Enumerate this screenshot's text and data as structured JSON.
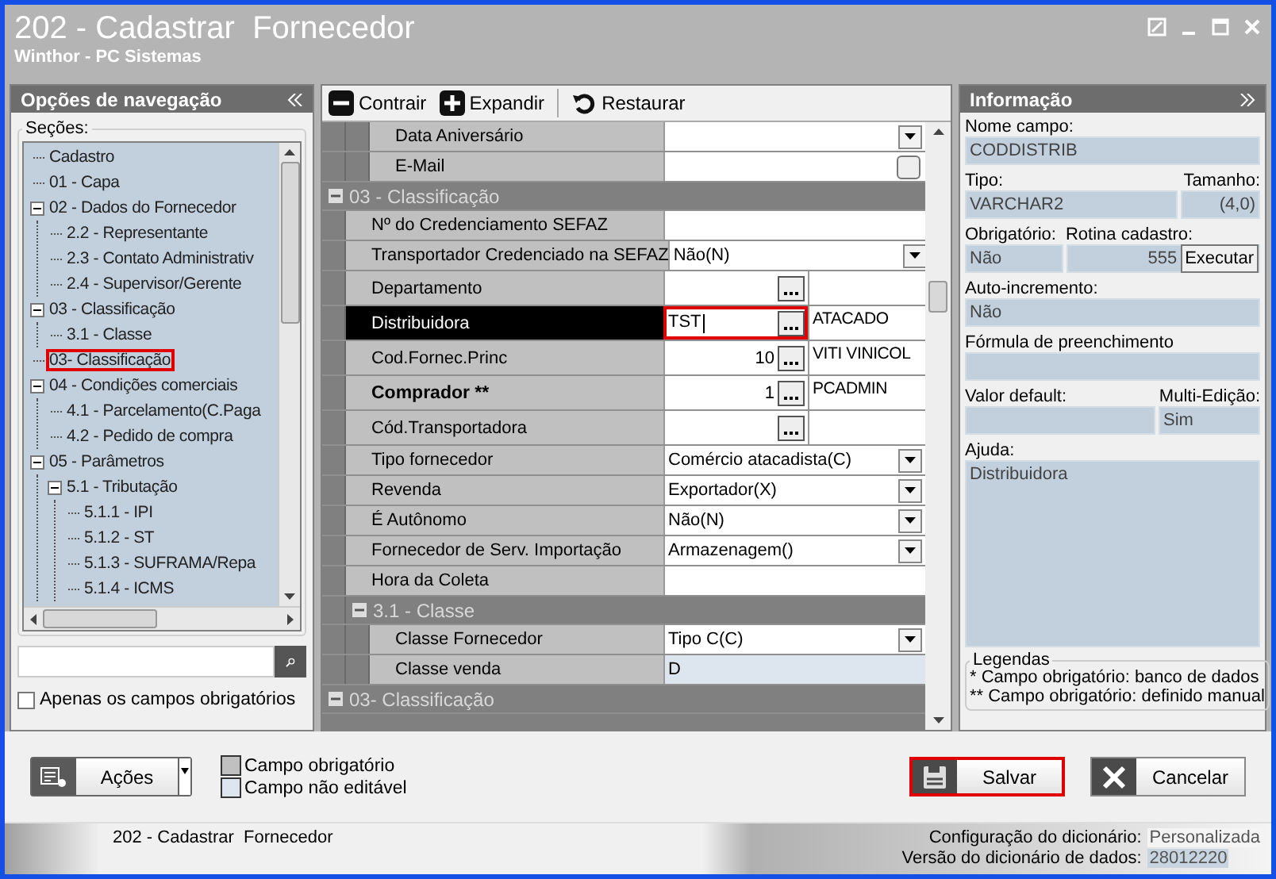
{
  "window": {
    "title": "202 - Cadastrar  Fornecedor",
    "subtitle": "Winthor - PC Sistemas"
  },
  "navigation": {
    "title": "Opções de navegação",
    "group_label": "Seções:",
    "tree": [
      {
        "label": "Cadastro",
        "highlighted": false
      },
      {
        "label": "01 - Capa",
        "highlighted": false
      },
      {
        "label": "02 - Dados do Fornecedor",
        "highlighted": false,
        "expanded": true,
        "children": [
          {
            "label": "2.2 - Representante",
            "highlighted": false
          },
          {
            "label": "2.3 - Contato Administrativ",
            "highlighted": false
          },
          {
            "label": "2.4 - Supervisor/Gerente",
            "highlighted": false
          }
        ]
      },
      {
        "label": "03 - Classificação",
        "highlighted": false,
        "expanded": true,
        "children": [
          {
            "label": "3.1 - Classe",
            "highlighted": false
          }
        ]
      },
      {
        "label": "03- Classificação",
        "highlighted": true
      },
      {
        "label": "04 - Condições comerciais",
        "highlighted": false,
        "expanded": true,
        "children": [
          {
            "label": "4.1 - Parcelamento(C.Paga",
            "highlighted": false
          },
          {
            "label": "4.2 - Pedido de compra",
            "highlighted": false
          }
        ]
      },
      {
        "label": "05 - Parâmetros",
        "highlighted": false,
        "expanded": true,
        "children": [
          {
            "label": "5.1 - Tributação",
            "highlighted": false,
            "expanded": true,
            "children": [
              {
                "label": "5.1.1 - IPI",
                "highlighted": false
              },
              {
                "label": "5.1.2 - ST",
                "highlighted": false
              },
              {
                "label": "5.1.3 - SUFRAMA/Repa",
                "highlighted": false
              },
              {
                "label": "5.1.4 - ICMS",
                "highlighted": false
              }
            ]
          }
        ]
      }
    ],
    "only_required": {
      "label": "Apenas os campos obrigatórios",
      "checked": false
    }
  },
  "toolbar": [
    "Contrair",
    "Expandir",
    "Restaurar"
  ],
  "grid": {
    "rows": [
      {
        "kind": "group",
        "children": [
          {
            "kind": "group",
            "children": [
              {
                "kind": "dropdown",
                "label": "Data Aniversário",
                "selected": false,
                "bold": false,
                "outlined": false,
                "readonly": false
              },
              {
                "kind": "button",
                "label": "E-Mail",
                "selected": false,
                "bold": false,
                "outlined": false,
                "readonly": false
              }
            ]
          }
        ]
      },
      {
        "kind": "group",
        "label": "03 - Classificação",
        "expanded": true,
        "children": [
          {
            "kind": "plain",
            "label": "Nº do Credenciamento SEFAZ",
            "selected": false,
            "bold": false,
            "outlined": false,
            "readonly": false
          },
          {
            "kind": "dropdown",
            "label": "Transportador Credenciado na SEFAZ",
            "value": "Não(N)",
            "selected": false,
            "bold": false,
            "outlined": false,
            "readonly": false
          },
          {
            "kind": "lookup",
            "label": "Departamento",
            "selected": false,
            "bold": false,
            "outlined": false,
            "readonly": false
          },
          {
            "kind": "lookup",
            "label": "Distribuidora",
            "value": "TST",
            "extra": "ATACADO",
            "selected": true,
            "bold": false,
            "outlined": true,
            "readonly": false
          },
          {
            "kind": "code",
            "label": "Cod.Fornec.Princ",
            "value": "10",
            "extra": "VITI VINICOL",
            "selected": false,
            "bold": false,
            "outlined": false,
            "readonly": false
          },
          {
            "kind": "code",
            "label": "Comprador **",
            "value": "1",
            "extra": "PCADMIN",
            "selected": false,
            "bold": true,
            "outlined": false,
            "readonly": false
          },
          {
            "kind": "lookup",
            "label": "Cód.Transportadora",
            "selected": false,
            "bold": false,
            "outlined": false,
            "readonly": false
          },
          {
            "kind": "dropdown",
            "label": "Tipo fornecedor",
            "value": "Comércio atacadista(C)",
            "selected": false,
            "bold": false,
            "outlined": false,
            "readonly": false
          },
          {
            "kind": "dropdown",
            "label": "Revenda",
            "value": "Exportador(X)",
            "selected": false,
            "bold": false,
            "outlined": false,
            "readonly": false
          },
          {
            "kind": "dropdown",
            "label": "É Autônomo",
            "value": "Não(N)",
            "selected": false,
            "bold": false,
            "outlined": false,
            "readonly": false
          },
          {
            "kind": "dropdown",
            "label": "Fornecedor de Serv. Importação",
            "value": "Armazenagem()",
            "selected": false,
            "bold": false,
            "outlined": false,
            "readonly": false
          },
          {
            "kind": "plain",
            "label": "Hora da Coleta",
            "selected": false,
            "bold": false,
            "outlined": false,
            "readonly": false
          },
          {
            "kind": "group",
            "label": "3.1 - Classe",
            "expanded": true,
            "children": [
              {
                "kind": "dropdown",
                "label": "Classe Fornecedor",
                "value": "Tipo C(C)",
                "selected": false,
                "bold": false,
                "outlined": false,
                "readonly": false
              },
              {
                "kind": "plain",
                "label": "Classe venda",
                "value": "D",
                "selected": false,
                "bold": false,
                "outlined": false,
                "readonly": true
              }
            ]
          }
        ]
      },
      {
        "kind": "group",
        "label": "03- Classificação",
        "expanded": true
      }
    ]
  },
  "info": {
    "title": "Informação",
    "field_name": {
      "label": "Nome campo:",
      "value": "CODDISTRIB"
    },
    "type": {
      "label": "Tipo:",
      "value": "VARCHAR2"
    },
    "size": {
      "label": "Tamanho:",
      "value": "(4,0)"
    },
    "required": {
      "label": "Obrigatório:",
      "value": "Não"
    },
    "routine": {
      "label": "Rotina cadastro:",
      "value": "555",
      "button": "Executar"
    },
    "auto_increment": {
      "label": "Auto-incremento:",
      "value": "Não"
    },
    "formula": {
      "label": "Fórmula de preenchimento"
    },
    "default": {
      "label": "Valor default:"
    },
    "multi_edit": {
      "label": "Multi-Edição:",
      "value": "Sim"
    },
    "help": {
      "label": "Ajuda:",
      "value": "Distribuidora"
    },
    "legend": {
      "title": "Legendas",
      "lines": [
        "* Campo obrigatório: banco de dados",
        "** Campo obrigatório: definido manual"
      ]
    }
  },
  "actions": {
    "label": "Ações"
  },
  "key": [
    {
      "label": "Campo obrigatório",
      "color": "#c0c0c0"
    },
    {
      "label": "Campo não editável",
      "color": "#dde6ee"
    }
  ],
  "buttons": [
    {
      "label": "Salvar",
      "kind": "save",
      "outlined": true
    },
    {
      "label": "Cancelar",
      "kind": "cancel",
      "outlined": false
    }
  ],
  "status_bar": {
    "text": "202 - Cadastrar  Fornecedor",
    "entries": [
      {
        "label": "Configuração do dicionário:",
        "value": "Personalizada"
      },
      {
        "label": "Versão do dicionário de dados:",
        "value": "28012220"
      }
    ]
  }
}
